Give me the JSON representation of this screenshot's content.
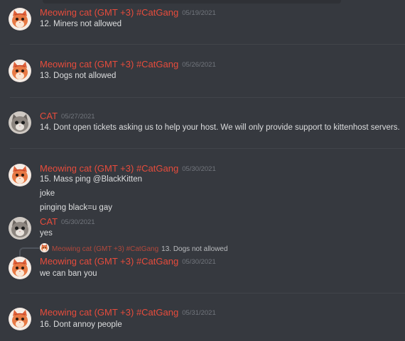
{
  "messages": [
    {
      "author": "Meowing cat (GMT +3) #CatGang",
      "date": "05/19/2021",
      "lines": [
        "12. Miners not allowed"
      ]
    },
    {
      "author": "Meowing cat (GMT +3) #CatGang",
      "date": "05/26/2021",
      "lines": [
        "13. Dogs not allowed"
      ]
    },
    {
      "author": "CAT",
      "date": "05/27/2021",
      "lines": [
        "14. Dont open tickets asking us to help your host. We will only provide support to kittenhost servers."
      ]
    },
    {
      "author": "Meowing cat (GMT +3) #CatGang",
      "date": "05/30/2021",
      "lines": [
        "15. Mass ping @BlackKitten",
        "joke",
        "pinging black=u gay"
      ]
    },
    {
      "author": "CAT",
      "date": "05/30/2021",
      "lines": [
        "yes"
      ]
    },
    {
      "reply_to": {
        "author": "Meowing cat (GMT +3) #CatGang",
        "text": "13. Dogs not allowed"
      },
      "author": "Meowing cat (GMT +3) #CatGang",
      "date": "05/30/2021",
      "lines": [
        "we can ban you"
      ]
    },
    {
      "author": "Meowing cat (GMT +3) #CatGang",
      "date": "05/31/2021",
      "lines": [
        "16. Dont annoy people"
      ]
    }
  ],
  "colors": {
    "background": "#36393f",
    "author_name": "#e74c3c",
    "timestamp": "#72767d",
    "message_text": "#dcddde"
  },
  "icons": {
    "meowing_cat_avatar": "orange-cat-avatar",
    "cat_avatar": "gray-cat-avatar"
  }
}
